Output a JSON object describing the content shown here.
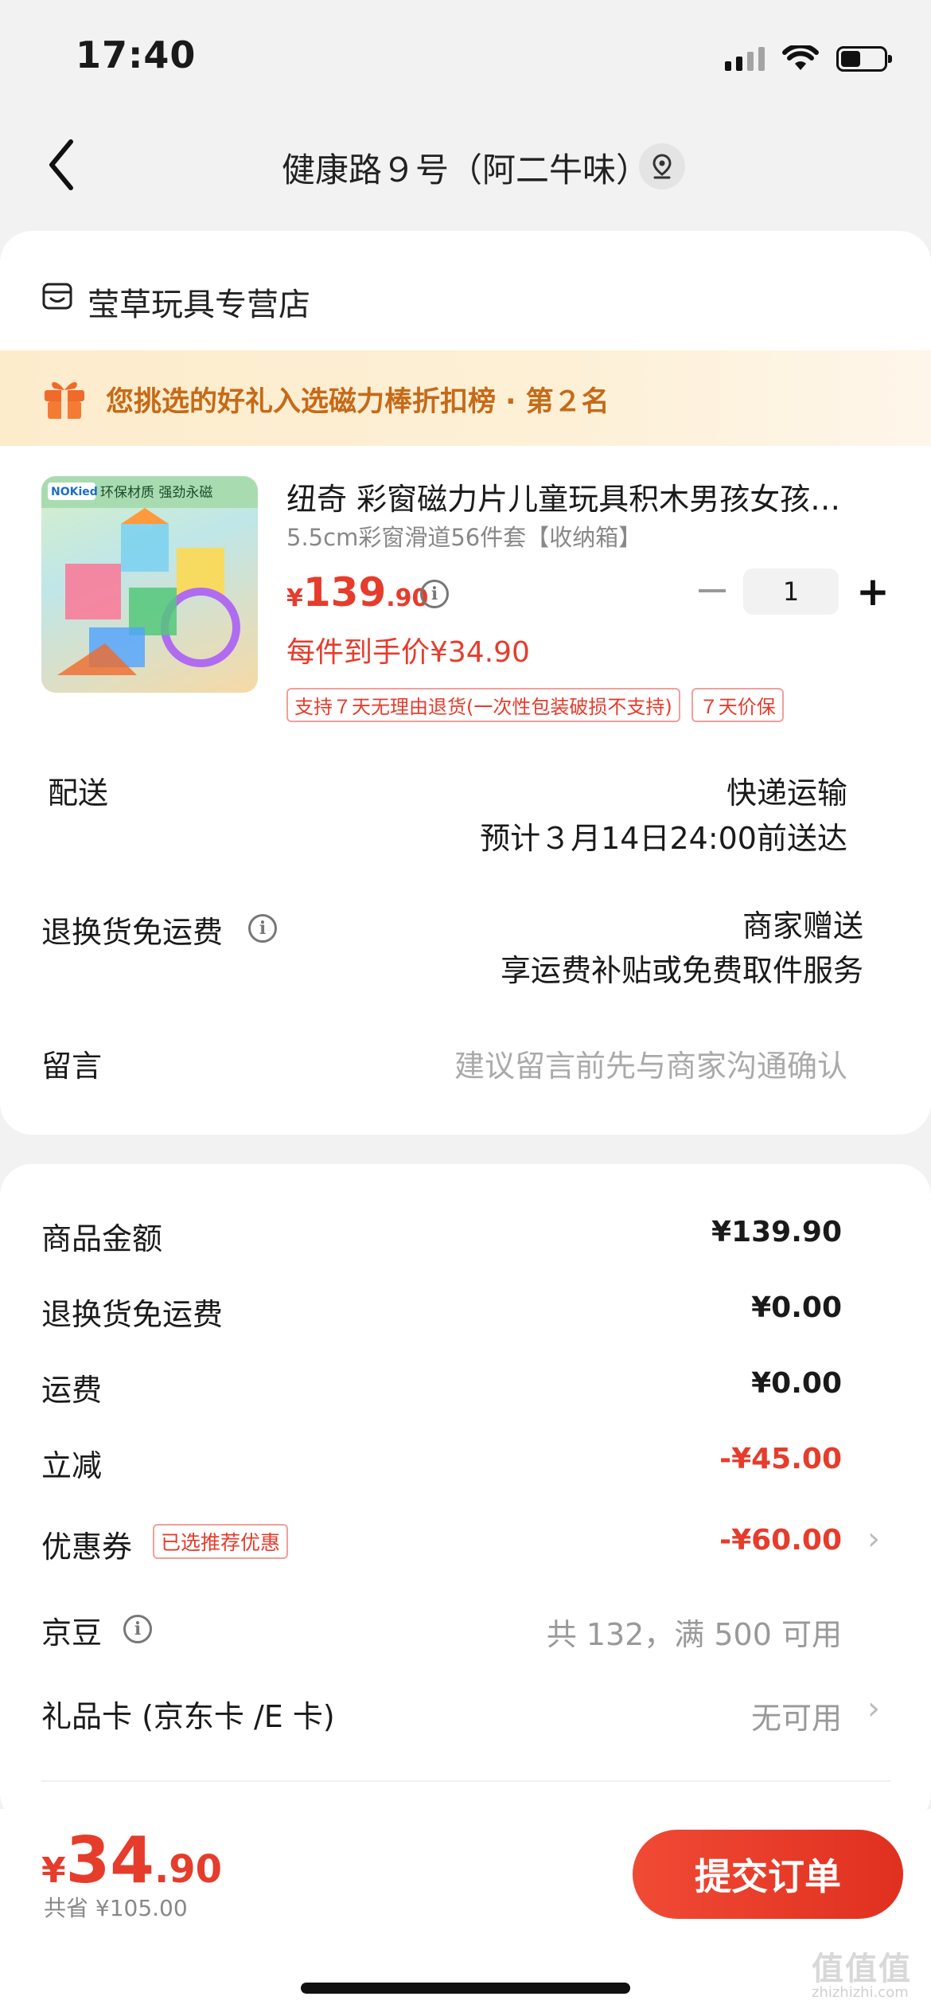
{
  "status_bar": {
    "time": "17:40"
  },
  "nav": {
    "title": "健康路９号（阿二牛味）"
  },
  "store": {
    "name": "莹草玩具专营店"
  },
  "banner": {
    "text": "您挑选的好礼入选磁力棒折扣榜 · 第２名"
  },
  "product": {
    "image_badge": "NOKied",
    "image_caption": "环保材质 强劲永磁",
    "title": "纽奇 彩窗磁力片儿童玩具积木男孩女孩…",
    "spec": "5.5cm彩窗滑道56件套【收纳箱】",
    "price_currency": "¥",
    "price_int": "139",
    "price_dec": ".90",
    "per_item_price": "每件到手价¥34.90",
    "quantity": "1",
    "tags": [
      "支持７天无理由退货(一次性包装破损不支持)",
      "７天价保"
    ]
  },
  "delivery": {
    "label": "配送",
    "method": "快递运输",
    "eta": "预计３月14日24:00前送达"
  },
  "return_shipping": {
    "label": "退换货免运费",
    "value_line1": "商家赠送",
    "value_line2": "享运费补贴或免费取件服务"
  },
  "message": {
    "label": "留言",
    "placeholder": "建议留言前先与商家沟通确认"
  },
  "summary": {
    "rows": [
      {
        "label": "商品金额",
        "value": "¥139.90"
      },
      {
        "label": "退换货免运费",
        "value": "¥0.00"
      },
      {
        "label": "运费",
        "value": "¥0.00"
      },
      {
        "label": "立减",
        "value": "-¥45.00"
      }
    ],
    "coupon": {
      "label": "优惠券",
      "badge": "已选推荐优惠",
      "value": "-¥60.00"
    },
    "jd_beans": {
      "label": "京豆",
      "value": "共 132，满 500 可用"
    },
    "gift_card": {
      "label": "礼品卡 (京东卡 /E 卡)",
      "value": "无可用"
    }
  },
  "footer": {
    "total_currency": "¥",
    "total_int": "34",
    "total_dec": ".90",
    "saved": "共省 ¥105.00",
    "submit_label": "提交订单"
  },
  "watermark": {
    "text": "值值值",
    "sub": "zhizhizhi.com"
  },
  "colors": {
    "accent": "#e63c2c",
    "banner_text": "#c66a18",
    "background": "#f2f2f2"
  }
}
